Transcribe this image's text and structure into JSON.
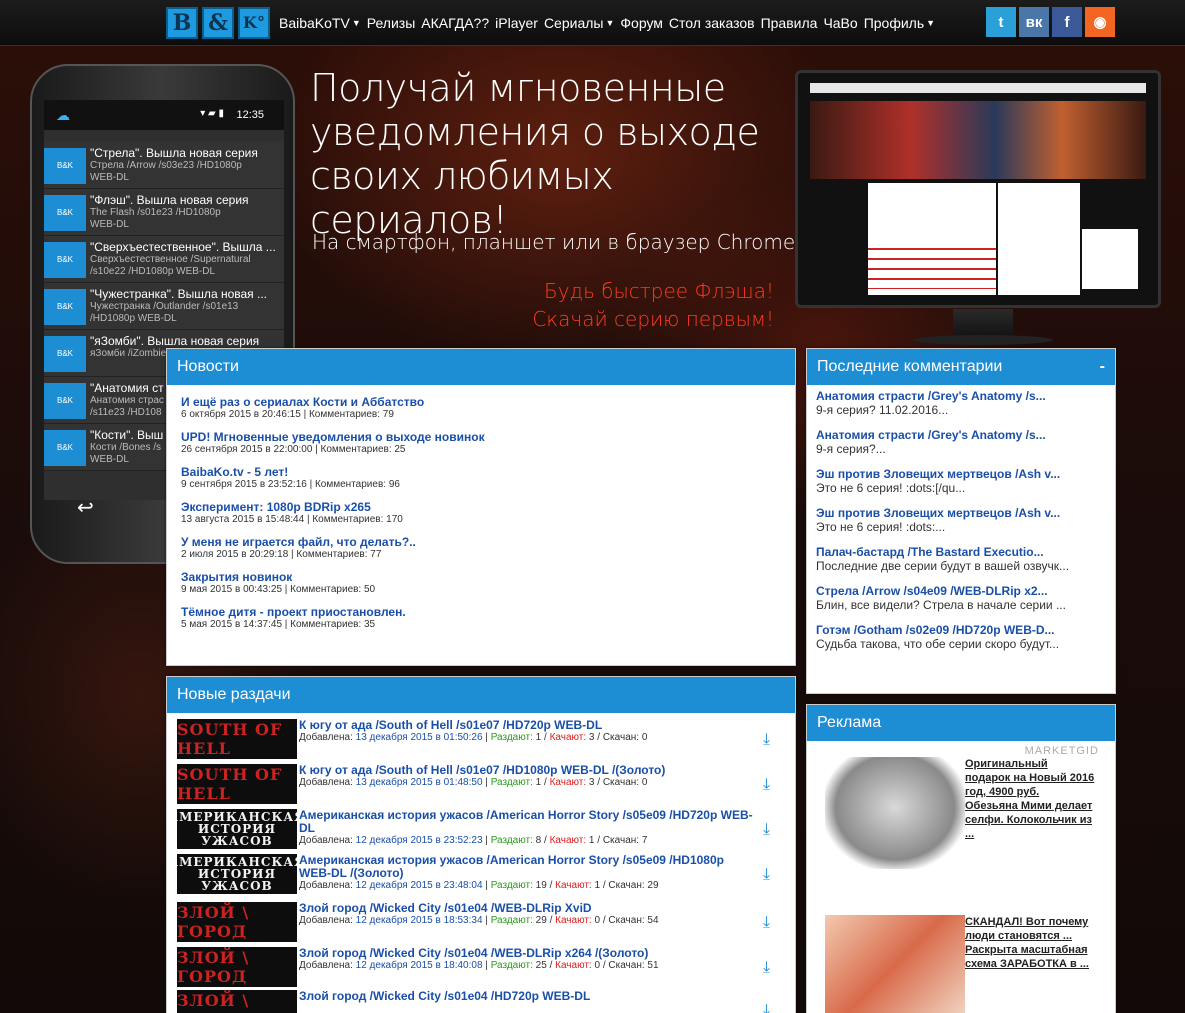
{
  "nav": {
    "logo": [
      "B",
      "&",
      "K°"
    ],
    "items": [
      {
        "label": "BaibaKoTV",
        "caret": true
      },
      {
        "label": "Релизы",
        "caret": false
      },
      {
        "label": "АКАГДА??",
        "caret": false
      },
      {
        "label": "iPlayer",
        "caret": false
      },
      {
        "label": "Сериалы",
        "caret": true
      },
      {
        "label": "Форум",
        "caret": false
      },
      {
        "label": "Стол заказов",
        "caret": false
      },
      {
        "label": "Правила",
        "caret": false
      },
      {
        "label": "ЧаВо",
        "caret": false
      },
      {
        "label": "Профиль",
        "caret": true
      }
    ],
    "social": [
      {
        "icon": "twitter-icon",
        "glyph": "t",
        "color": "#2a9fd8"
      },
      {
        "icon": "vk-icon",
        "glyph": "вк",
        "color": "#4a76a8"
      },
      {
        "icon": "facebook-icon",
        "glyph": "f",
        "color": "#3b5998"
      },
      {
        "icon": "rss-icon",
        "glyph": "◉",
        "color": "#f26522"
      }
    ]
  },
  "phone": {
    "time": "12:35",
    "notifications": [
      {
        "title": "\"Стрела\". Вышла новая серия",
        "line2": "Стрела /Arrow /s03e23 /HD1080p",
        "line3": "WEB-DL"
      },
      {
        "title": "\"Флэш\". Вышла новая серия",
        "line2": "The Flash /s01e23 /HD1080p",
        "line3": "WEB-DL"
      },
      {
        "title": "\"Сверхъестественное\". Вышла ...",
        "line2": "Сверхъестественное /Supernatural",
        "line3": "/s10e22 /HD1080p WEB-DL"
      },
      {
        "title": "\"Чужестранка\". Вышла новая ...",
        "line2": "Чужестранка /Outlander /s01e13",
        "line3": "/HD1080p WEB-DL"
      },
      {
        "title": "\"яЗомби\". Вышла новая серия",
        "line2": "яЗомби /iZombie",
        "line3": ""
      },
      {
        "title": "\"Анатомия ст",
        "line2": "Анатомия страс",
        "line3": "/s11e23 /HD108"
      },
      {
        "title": "\"Кости\". Выш",
        "line2": "Кости /Bones /s",
        "line3": "WEB-DL"
      }
    ]
  },
  "hero": {
    "headline": "Получай мгновенные уведомления о выходе своих любимых сериалов!",
    "sub": "На смартфон, планшет или в браузер Chrome.",
    "red1": "Будь быстрее Флэша!",
    "red2": "Скачай серию первым!"
  },
  "news": {
    "title": "Новости",
    "items": [
      {
        "title": "И ещё раз о сериалах Кости и Аббатство",
        "meta": "6 октября 2015 в 20:46:15 | Комментариев: 79"
      },
      {
        "title": "UPD! Мгновенные уведомления о выходе новинок",
        "meta": "26 сентября 2015 в 22:00:00 | Комментариев: 25"
      },
      {
        "title": "BaibaKo.tv - 5 лет!",
        "meta": "9 сентября 2015 в 23:52:16 | Комментариев: 96"
      },
      {
        "title": "Эксперимент: 1080p BDRip x265",
        "meta": "13 августа 2015 в 15:48:44 | Комментариев: 170"
      },
      {
        "title": "У меня не играется файл, что делать?..",
        "meta": "2 июля 2015 в 20:29:18 | Комментариев: 77"
      },
      {
        "title": "Закрытия новинок",
        "meta": "9 мая 2015 в 00:43:25 | Комментариев: 50"
      },
      {
        "title": "Тёмное дитя - проект приостановлен.",
        "meta": "5 мая 2015 в 14:37:45 | Комментариев: 35"
      }
    ]
  },
  "comments": {
    "title": "Последние комментарии",
    "collapse": "-",
    "items": [
      {
        "title": "Анатомия страсти /Grey's Anatomy /s...",
        "text": "9-я серия? 11.02.2016..."
      },
      {
        "title": "Анатомия страсти /Grey's Anatomy /s...",
        "text": "9-я серия?..."
      },
      {
        "title": "Эш против Зловещих мертвецов /Ash v...",
        "text": "Это не 6 серия! :dots:[/qu..."
      },
      {
        "title": "Эш против Зловещих мертвецов /Ash v...",
        "text": "Это не 6 серия! :dots:..."
      },
      {
        "title": "Палач-бастард /The Bastard Executio...",
        "text": "Последние две серии будут в вашей озвучк..."
      },
      {
        "title": "Стрела /Arrow /s04e09 /WEB-DLRip x2...",
        "text": "Блин, все видели? Стрела в начале серии ..."
      },
      {
        "title": "Готэм /Gotham /s02e09 /HD720p WEB-D...",
        "text": "Судьба такова, что обе серии скоро будут..."
      }
    ]
  },
  "releases": {
    "title": "Новые раздачи",
    "added_label": "Добавлена:",
    "seed_label": "Раздают:",
    "leech_label": "Качают:",
    "dl_label": "Скачан:",
    "items": [
      {
        "thumb": "SOUTH OF HELL",
        "thumbStyle": "r",
        "title": "К югу от ада /South of Hell /s01e07 /HD720p WEB-DL",
        "date": "13 декабря 2015 в 01:50:26",
        "seed": "1",
        "leech": "3",
        "dl": "0"
      },
      {
        "thumb": "SOUTH OF HELL",
        "thumbStyle": "r",
        "title": "К югу от ада /South of Hell /s01e07 /HD1080p WEB-DL /(Золото)",
        "date": "13 декабря 2015 в 01:48:50",
        "seed": "1",
        "leech": "3",
        "dl": "0"
      },
      {
        "thumb": "АМЕРИКАНСКАЯ ИСТОРИЯ УЖАСОВ",
        "thumbStyle": "w",
        "title": "Американская история ужасов /American Horror Story /s05e09 /HD720p WEB-DL",
        "date": "12 декабря 2015 в 23:52:23",
        "seed": "8",
        "leech": "1",
        "dl": "7"
      },
      {
        "thumb": "АМЕРИКАНСКАЯ ИСТОРИЯ УЖАСОВ",
        "thumbStyle": "w",
        "title": "Американская история ужасов /American Horror Story /s05e09 /HD1080p WEB-DL /(Золото)",
        "date": "12 декабря 2015 в 23:48:04",
        "seed": "19",
        "leech": "1",
        "dl": "29"
      },
      {
        "thumb": "ЗЛОЙ \\ ГОРОД",
        "thumbStyle": "r",
        "title": "Злой город /Wicked City /s01e04 /WEB-DLRip XviD",
        "date": "12 декабря 2015 в 18:53:34",
        "seed": "29",
        "leech": "0",
        "dl": "54"
      },
      {
        "thumb": "ЗЛОЙ \\ ГОРОД",
        "thumbStyle": "r",
        "title": "Злой город /Wicked City /s01e04 /WEB-DLRip x264 /(Золото)",
        "date": "12 декабря 2015 в 18:40:08",
        "seed": "25",
        "leech": "0",
        "dl": "51"
      },
      {
        "thumb": "ЗЛОЙ \\ ГОРОД",
        "thumbStyle": "r",
        "title": "Злой город /Wicked City /s01e04 /HD720p WEB-DL",
        "date": "",
        "seed": "",
        "leech": "",
        "dl": ""
      }
    ]
  },
  "ads": {
    "title": "Реклама",
    "network": "MARKETGID",
    "items": [
      {
        "text": "Оригинальный подарок на Новый 2016 год, 4900 руб. Обезьяна Мими делает селфи. Колокольчик из ..."
      },
      {
        "text": "СКАНДАЛ! Вот почему люди становятся ... Раскрыта масштабная схема ЗАРАБОТКА в ..."
      }
    ]
  }
}
